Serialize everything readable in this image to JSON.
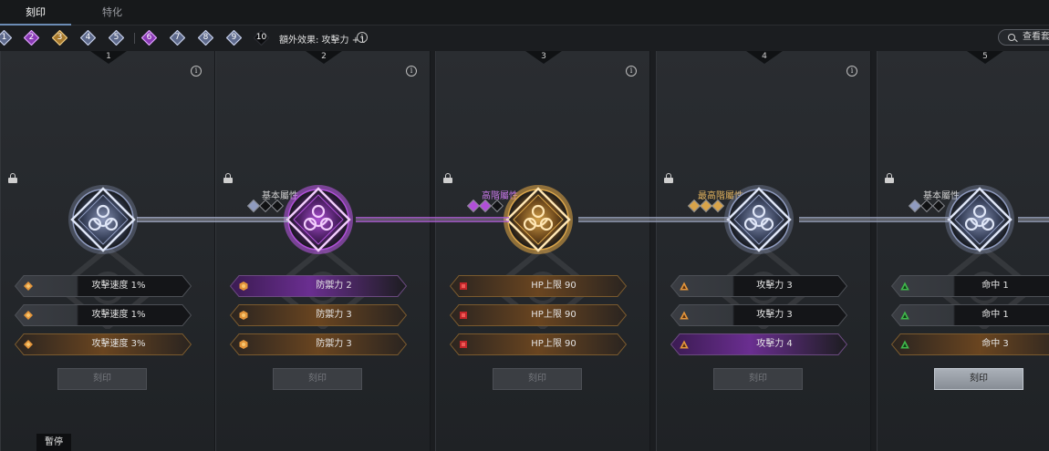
{
  "tabs": [
    {
      "label": "刻印",
      "active": true
    },
    {
      "label": "特化",
      "active": false
    }
  ],
  "levels": [
    {
      "num": "1",
      "state": "normal"
    },
    {
      "num": "2",
      "state": "purple"
    },
    {
      "num": "3",
      "state": "gold"
    },
    {
      "num": "4",
      "state": "normal"
    },
    {
      "num": "5",
      "state": "normal"
    },
    {
      "num": "6",
      "state": "purple"
    },
    {
      "num": "7",
      "state": "normal"
    },
    {
      "num": "8",
      "state": "normal"
    },
    {
      "num": "9",
      "state": "normal"
    },
    {
      "num": "10",
      "state": "dark"
    }
  ],
  "bonus": {
    "text": "額外效果: 攻擊力 +1"
  },
  "view_button": {
    "label": "查看套"
  },
  "cards": [
    {
      "index": "1",
      "grade": "",
      "rarity": "normal",
      "gem_count": 0,
      "stats": [
        {
          "text": "攻擊速度 1%",
          "icon": "orange-diamond-icon",
          "style": "dark"
        },
        {
          "text": "攻擊速度 1%",
          "icon": "orange-diamond-icon",
          "style": "dark"
        },
        {
          "text": "攻擊速度 3%",
          "icon": "orange-diamond-icon",
          "style": "gold"
        }
      ],
      "button": "刻印",
      "button_active": false
    },
    {
      "index": "2",
      "grade": "基本屬性",
      "rarity": "purple",
      "gem_count": 1,
      "stats": [
        {
          "text": "防禦力 2",
          "icon": "orange-hexagon-icon",
          "style": "purple"
        },
        {
          "text": "防禦力 3",
          "icon": "orange-hexagon-icon",
          "style": "gold"
        },
        {
          "text": "防禦力 3",
          "icon": "orange-hexagon-icon",
          "style": "gold"
        }
      ],
      "button": "刻印",
      "button_active": false
    },
    {
      "index": "3",
      "grade": "高階屬性",
      "rarity": "gold",
      "gem_count": 2,
      "stats": [
        {
          "text": "HP上限 90",
          "icon": "red-square-icon",
          "style": "gold"
        },
        {
          "text": "HP上限 90",
          "icon": "red-square-icon",
          "style": "gold"
        },
        {
          "text": "HP上限 90",
          "icon": "red-square-icon",
          "style": "gold"
        }
      ],
      "button": "刻印",
      "button_active": false
    },
    {
      "index": "4",
      "grade": "最高階屬性",
      "rarity": "normal",
      "gem_count": 3,
      "stats": [
        {
          "text": "攻擊力 3",
          "icon": "orange-triangle-icon",
          "style": "dark"
        },
        {
          "text": "攻擊力 3",
          "icon": "orange-triangle-icon",
          "style": "dark"
        },
        {
          "text": "攻擊力 4",
          "icon": "orange-triangle-icon",
          "style": "purple"
        }
      ],
      "button": "刻印",
      "button_active": false
    },
    {
      "index": "5",
      "grade": "基本屬性",
      "rarity": "normal",
      "gem_count": 1,
      "stats": [
        {
          "text": "命中 1",
          "icon": "green-triangle-icon",
          "style": "dark"
        },
        {
          "text": "命中 1",
          "icon": "green-triangle-icon",
          "style": "dark"
        },
        {
          "text": "命中 3",
          "icon": "green-triangle-icon",
          "style": "gold"
        }
      ],
      "button": "刻印",
      "button_active": true
    }
  ],
  "pause": {
    "label": "暫停"
  },
  "colors": {
    "purple": "#b04fd8",
    "gold": "#d9a44a",
    "silver": "#b9c3de",
    "accent_tab": "#6c8cb5"
  }
}
